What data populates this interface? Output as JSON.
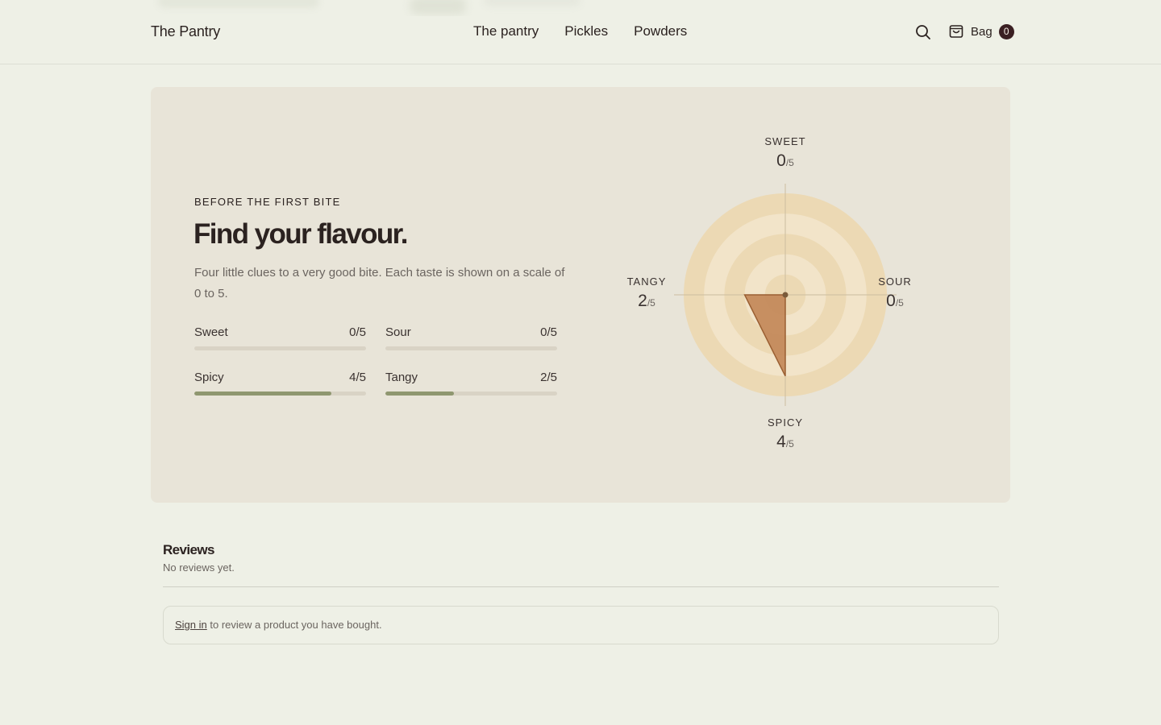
{
  "header": {
    "brand": "The Pantry",
    "nav": [
      "The pantry",
      "Pickles",
      "Powders"
    ],
    "bag_label": "Bag",
    "bag_count": "0"
  },
  "flavour": {
    "eyebrow": "BEFORE THE FIRST BITE",
    "headline": "Find your flavour.",
    "description": "Four little clues to a very good bite. Each taste is shown on a scale of 0 to 5.",
    "meters": [
      {
        "label": "Sweet",
        "value": 0,
        "max": 5,
        "display": "0/5"
      },
      {
        "label": "Sour",
        "value": 0,
        "max": 5,
        "display": "0/5"
      },
      {
        "label": "Spicy",
        "value": 4,
        "max": 5,
        "display": "4/5"
      },
      {
        "label": "Tangy",
        "value": 2,
        "max": 5,
        "display": "2/5"
      }
    ]
  },
  "chart_data": {
    "type": "radar",
    "axes": [
      "SWEET",
      "SOUR",
      "SPICY",
      "TANGY"
    ],
    "values": [
      0,
      0,
      4,
      2
    ],
    "max": 5,
    "scale_suffix": "/5",
    "colors": {
      "fill": "#c48a5c",
      "stroke": "#9a5f32",
      "rings_outer": "#ecd9b4",
      "rings_inner": "#f2e4c9"
    }
  },
  "reviews": {
    "title": "Reviews",
    "empty": "No reviews yet.",
    "signin_link": "Sign in",
    "signin_rest": " to review a product you have bought."
  }
}
